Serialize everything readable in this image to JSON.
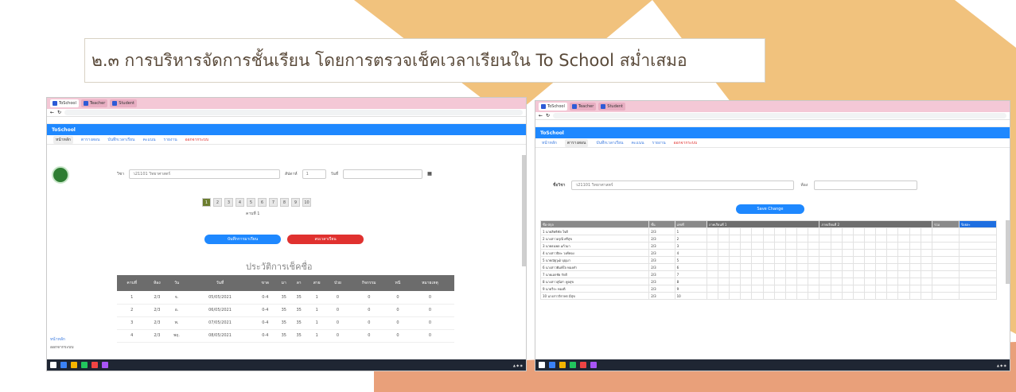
{
  "slide": {
    "title": "๒.๓ การบริหารจัดการชั้นเรียน โดยการตรวจเช็คเวลาเรียนใน To School สม่ำเสมอ"
  },
  "colors": {
    "decoration_orange": "#f1c27d",
    "decoration_salmon": "#e9a07a",
    "navbar": "#1e88ff",
    "chrome_tabs": "#f4c8d6"
  },
  "left_window": {
    "tabs": [
      "ToSchool",
      "Teacher",
      "Student"
    ],
    "nav_brand": "ToSchool",
    "menu_items": [
      "หน้าหลัก",
      "ตารางสอน",
      "บันทึกเวลาเรียน",
      "คะแนน",
      "รายงาน",
      "ออกจากระบบ"
    ],
    "filter_label": "วิชา",
    "filter_value": "ว21101 วิทยาศาสตร์",
    "week_label": "สัปดาห์",
    "week_value": "1",
    "date_label": "วันที่",
    "date_value": "",
    "pages": [
      "1",
      "2",
      "3",
      "4",
      "5",
      "6",
      "7",
      "8",
      "9",
      "10"
    ],
    "page_caption": "คาบที่ 1",
    "btn_save": "บันทึกการมาเรียน",
    "btn_delete": "ลบเวลาเรียน",
    "history_title": "ประวัติการเช็คชื่อ",
    "table_headers": [
      "คาบที่",
      "ห้อง",
      "วัน",
      "วันที่",
      "ขาด",
      "มา",
      "ลา",
      "สาย",
      "ป่วย",
      "กิจกรรม",
      "หนี",
      "หมายเหตุ"
    ],
    "table_rows": [
      [
        "1",
        "2/3",
        "จ.",
        "05/05/2021",
        "0-4",
        "35",
        "35",
        "1",
        "0",
        "0",
        "0",
        "0"
      ],
      [
        "2",
        "2/3",
        "อ.",
        "06/05/2021",
        "0-4",
        "35",
        "35",
        "1",
        "0",
        "0",
        "0",
        "0"
      ],
      [
        "3",
        "2/3",
        "พ.",
        "07/05/2021",
        "0-4",
        "35",
        "35",
        "1",
        "0",
        "0",
        "0",
        "0"
      ],
      [
        "4",
        "2/3",
        "พฤ.",
        "08/05/2021",
        "0-4",
        "35",
        "35",
        "1",
        "0",
        "0",
        "0",
        "0"
      ]
    ],
    "sidebar_items": [
      "หน้าหลัก",
      "ออกจากระบบ"
    ]
  },
  "right_window": {
    "tabs": [
      "ToSchool",
      "Teacher",
      "Student"
    ],
    "nav_brand": "ToSchool",
    "menu_items": [
      "หน้าหลัก",
      "ตารางสอน",
      "บันทึกเวลาเรียน",
      "คะแนน",
      "รายงาน",
      "ออกจากระบบ"
    ],
    "filter_label": "ชื่อวิชา",
    "filter_value": "ว21101 วิทยาศาสตร์",
    "filter2_label": "ห้อง",
    "btn_change": "Save Change",
    "table_group_headers": [
      "ชื่อ-สกุล",
      "ชั้น",
      "เลขที่",
      "ภาคเรียนที่ 1",
      "ภาคเรียนที่ 2",
      "รวม",
      "ร้อยละ"
    ],
    "students": [
      [
        "1",
        "นายสิทธิชัย ใจดี",
        "2/3",
        "1"
      ],
      [
        "2",
        "นางสาวอรุณี ศรีสุข",
        "2/3",
        "2"
      ],
      [
        "3",
        "นายธนพล แก้วมา",
        "2/3",
        "3"
      ],
      [
        "4",
        "นางสาวปิยะ วงศ์ทอง",
        "2/3",
        "4"
      ],
      [
        "5",
        "นายณัฐวุฒิ บุญมา",
        "2/3",
        "5"
      ],
      [
        "6",
        "นางสาวพิมพ์ใจ ทองคำ",
        "2/3",
        "6"
      ],
      [
        "7",
        "นายเอกชัย รักดี",
        "2/3",
        "7"
      ],
      [
        "8",
        "นางสาวสุนิสา พูลสุข",
        "2/3",
        "8"
      ],
      [
        "9",
        "นายวีระ ทองดี",
        "2/3",
        "9"
      ],
      [
        "10",
        "นางสาวจิราพร มีสุข",
        "2/3",
        "10"
      ]
    ]
  }
}
